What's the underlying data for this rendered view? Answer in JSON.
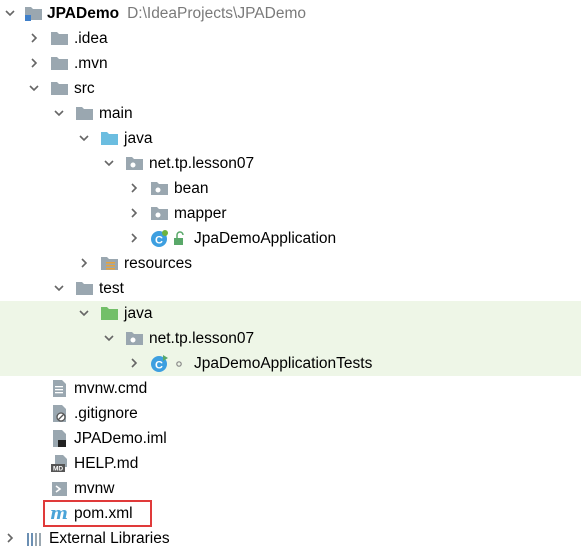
{
  "tree": {
    "root": {
      "label": "JPADemo",
      "path": "D:\\IdeaProjects\\JPADemo"
    },
    "idea": {
      "label": ".idea"
    },
    "mvn": {
      "label": ".mvn"
    },
    "src": {
      "label": "src"
    },
    "main": {
      "label": "main"
    },
    "main_java": {
      "label": "java"
    },
    "main_pkg": {
      "label": "net.tp.lesson07"
    },
    "bean": {
      "label": "bean"
    },
    "mapper": {
      "label": "mapper"
    },
    "app": {
      "label": "JpaDemoApplication"
    },
    "resources": {
      "label": "resources"
    },
    "test": {
      "label": "test"
    },
    "test_java": {
      "label": "java"
    },
    "test_pkg": {
      "label": "net.tp.lesson07"
    },
    "app_tests": {
      "label": "JpaDemoApplicationTests"
    },
    "mvnw_cmd": {
      "label": "mvnw.cmd"
    },
    "gitignore": {
      "label": ".gitignore"
    },
    "iml": {
      "label": "JPADemo.iml"
    },
    "help": {
      "label": "HELP.md"
    },
    "mvnw": {
      "label": "mvnw"
    },
    "pom": {
      "label": "pom.xml"
    },
    "ext_libs": {
      "label": "External Libraries"
    }
  },
  "colors": {
    "folder": "#9aa7b0",
    "source_folder": "#6bbde0",
    "test_folder": "#73bf69",
    "test_highlight": "#eef6e7",
    "class_icon": "#3d9fe0",
    "selection_box": "#e03a3a"
  }
}
